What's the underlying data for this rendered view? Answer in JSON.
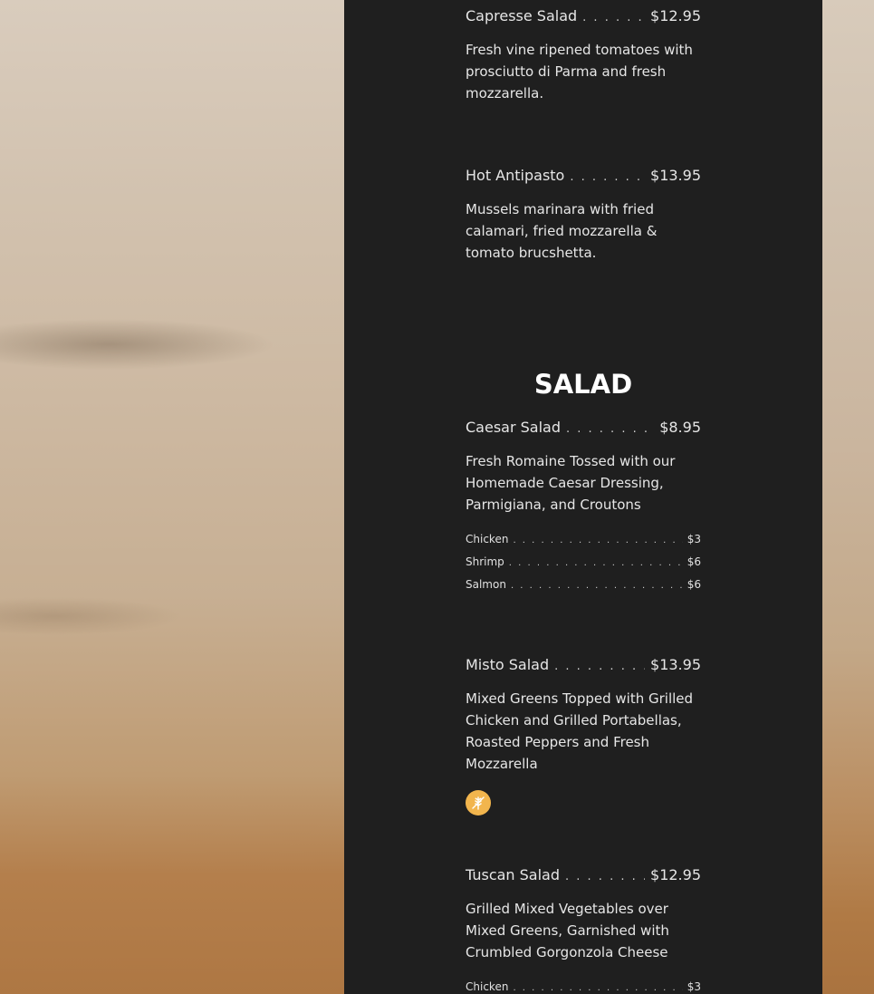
{
  "dots": ". . . . . . . . . . . . . . . . . . . . . . . . . . . . . . . . . . . . . . . . . . . . . .",
  "items": {
    "capresse": {
      "name": "Capresse Salad",
      "price": "$12.95",
      "description": "Fresh vine ripened tomatoes with prosciutto di Parma and fresh mozzarella."
    },
    "antipasto": {
      "name": "Hot Antipasto",
      "price": "$13.95",
      "description": "Mussels marinara with fried calamari, fried mozzarella & tomato brucshetta."
    },
    "caesar": {
      "name": "Caesar Salad",
      "price": "$8.95",
      "description": "Fresh Romaine Tossed with our Homemade Caesar Dressing, Parmigiana, and Croutons"
    },
    "misto": {
      "name": "Misto Salad",
      "price": "$13.95",
      "description": "Mixed Greens Topped with Grilled Chicken and Grilled Portabellas, Roasted Peppers and Fresh Mozzarella"
    },
    "tuscan": {
      "name": "Tuscan Salad",
      "price": "$12.95",
      "description": "Grilled Mixed Vegetables over Mixed Greens, Garnished with Crumbled Gorgonzola Cheese"
    }
  },
  "section": {
    "title": "SALAD"
  },
  "caesar_addons": [
    {
      "name": "Chicken",
      "price": "$3"
    },
    {
      "name": "Shrimp",
      "price": "$6"
    },
    {
      "name": "Salmon",
      "price": "$6"
    }
  ],
  "tuscan_addons": [
    {
      "name": "Chicken",
      "price": "$3"
    }
  ],
  "icons": {
    "gluten_free": "gluten-free-icon",
    "badge_color": "#f2b54d"
  },
  "colors": {
    "panel": "#1f1f1f",
    "text": "#e6e6e6",
    "heading": "#ffffff"
  }
}
